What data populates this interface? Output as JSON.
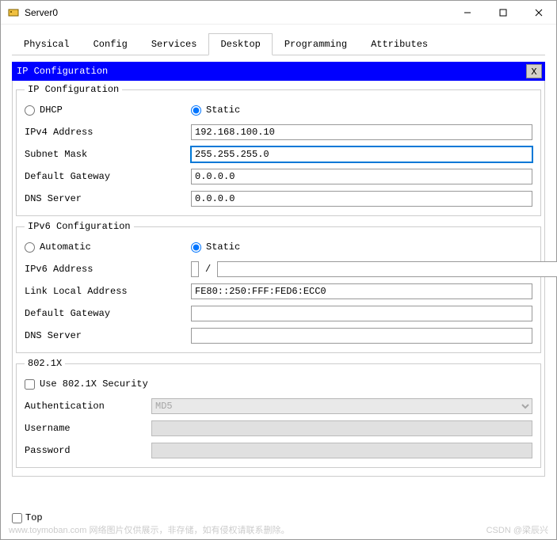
{
  "window": {
    "title": "Server0"
  },
  "tabs": {
    "items": [
      "Physical",
      "Config",
      "Services",
      "Desktop",
      "Programming",
      "Attributes"
    ],
    "active": "Desktop"
  },
  "panel": {
    "title": "IP Configuration",
    "close": "X"
  },
  "ipv4": {
    "legend": "IP Configuration",
    "dhcp_label": "DHCP",
    "static_label": "Static",
    "mode": "static",
    "addr_label": "IPv4 Address",
    "addr_value": "192.168.100.10",
    "mask_label": "Subnet Mask",
    "mask_value": "255.255.255.0",
    "gw_label": "Default Gateway",
    "gw_value": "0.0.0.0",
    "dns_label": "DNS Server",
    "dns_value": "0.0.0.0"
  },
  "ipv6": {
    "legend": "IPv6 Configuration",
    "auto_label": "Automatic",
    "static_label": "Static",
    "mode": "static",
    "addr_label": "IPv6 Address",
    "addr_value": "",
    "prefix_value": "",
    "ll_label": "Link Local Address",
    "ll_value": "FE80::250:FFF:FED6:ECC0",
    "gw_label": "Default Gateway",
    "gw_value": "",
    "dns_label": "DNS Server",
    "dns_value": ""
  },
  "dot1x": {
    "legend": "802.1X",
    "use_label": "Use 802.1X Security",
    "use_checked": false,
    "auth_label": "Authentication",
    "auth_value": "MD5",
    "user_label": "Username",
    "user_value": "",
    "pass_label": "Password",
    "pass_value": ""
  },
  "footer": {
    "top_label": "Top",
    "top_checked": false
  },
  "watermark": {
    "left": "www.toymoban.com  网络图片仅供展示，非存储，如有侵权请联系删除。",
    "right": "CSDN @梁辰兴"
  }
}
